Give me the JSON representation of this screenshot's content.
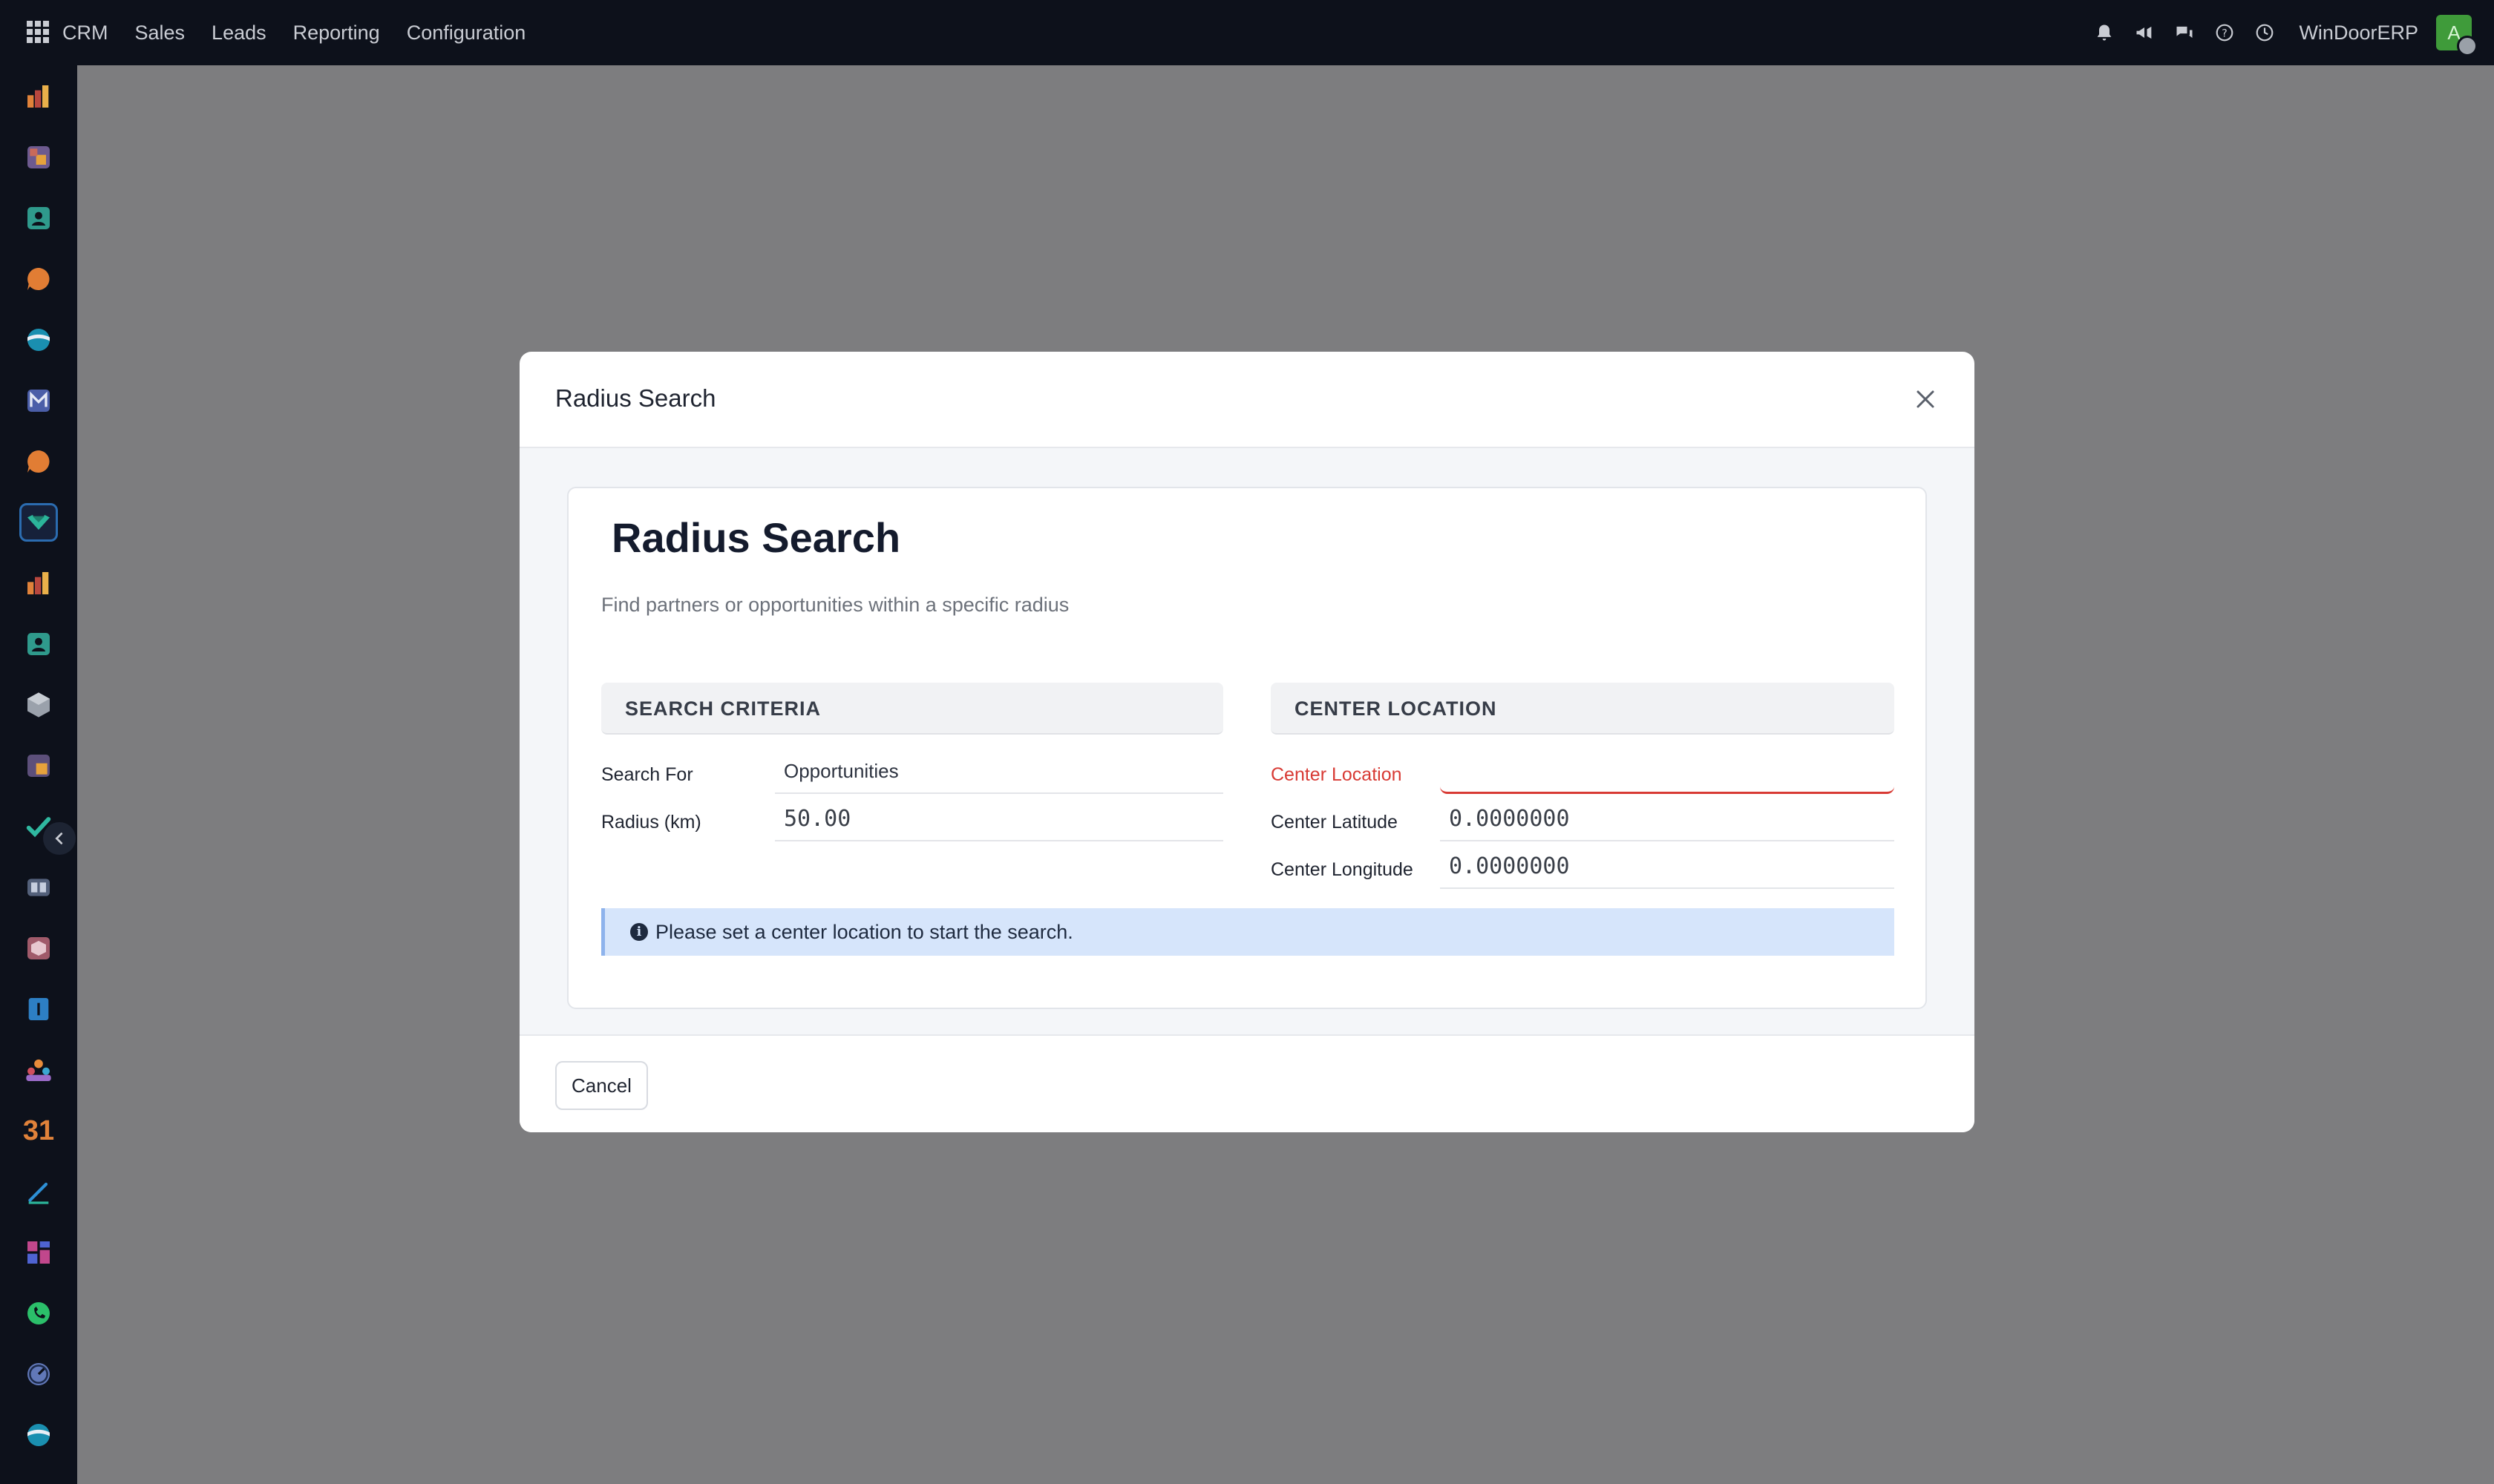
{
  "topbar": {
    "menu": [
      "CRM",
      "Sales",
      "Leads",
      "Reporting",
      "Configuration"
    ],
    "company": "WinDoorERP",
    "avatar_initial": "A",
    "icons": [
      "bell-icon",
      "megaphone-icon",
      "chat-icon",
      "help-icon",
      "clock-icon"
    ]
  },
  "sidebar": {
    "icons": [
      "chart-app-icon",
      "puzzle-app-icon",
      "contacts-app-icon",
      "chat-bubble-app-icon",
      "sphere-app-icon",
      "mail-app-icon",
      "discuss-app-icon",
      "crm-app-icon",
      "sales-chart-app-icon",
      "contacts-app-icon-2",
      "package-app-icon",
      "apps-app-icon",
      "check-app-icon",
      "book-app-icon",
      "inventory-app-icon",
      "invoice-app-icon",
      "team-app-icon",
      "calendar-app-icon",
      "sign-app-icon",
      "dashboard-app-icon",
      "whatsapp-app-icon",
      "time-app-icon",
      "sphere-app-icon-2"
    ],
    "calendar_label": "31"
  },
  "modal": {
    "title": "Radius Search",
    "heading": "Radius Search",
    "subtitle": "Find partners or opportunities within a specific radius",
    "search_criteria": {
      "header": "SEARCH CRITERIA",
      "search_for_label": "Search For",
      "search_for_value": "Opportunities",
      "radius_label": "Radius (km)",
      "radius_value": "50.00"
    },
    "center_location": {
      "header": "CENTER LOCATION",
      "location_label": "Center Location",
      "location_value": "",
      "latitude_label": "Center Latitude",
      "latitude_value": "0.0000000",
      "longitude_label": "Center Longitude",
      "longitude_value": "0.0000000"
    },
    "alert": "Please set a center location to start the search.",
    "cancel_label": "Cancel"
  },
  "colors": {
    "navbar": "#0d111b",
    "overlay": "#7d7d7f",
    "required": "#d83a34",
    "alert_bg": "#d6e5fb"
  }
}
